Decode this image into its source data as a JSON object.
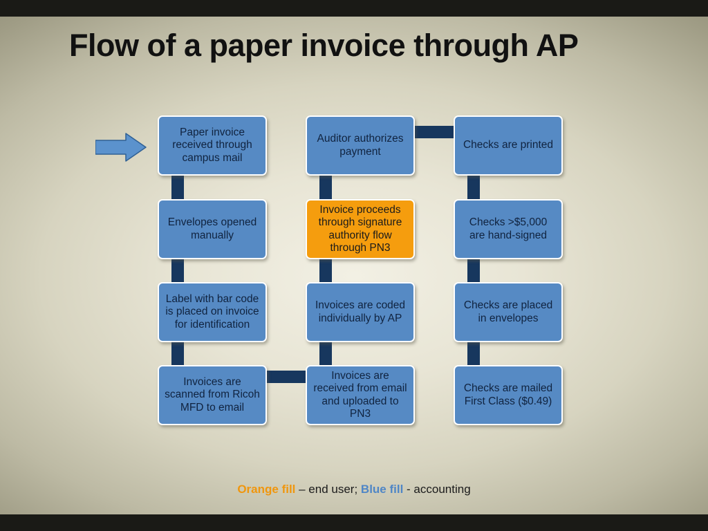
{
  "slide": {
    "title": "Flow of a paper invoice through AP",
    "legend": {
      "orange_label": "Orange fill",
      "orange_desc": " – end user; ",
      "blue_label": "Blue fill",
      "blue_desc": " - accounting"
    },
    "colors": {
      "blue_fill": "#568ac4",
      "orange_fill": "#f59d0e",
      "connector": "#17375e",
      "node_border": "#ffffff",
      "title_text": "#111111",
      "node_text": "#10233f",
      "band": "#1a1a16"
    }
  },
  "nodes": [
    {
      "id": "n1",
      "text": "Paper invoice received through campus mail",
      "fill": "blue"
    },
    {
      "id": "n2",
      "text": "Envelopes opened manually",
      "fill": "blue"
    },
    {
      "id": "n3",
      "text": "Label with bar code is placed on invoice for identification",
      "fill": "blue"
    },
    {
      "id": "n4",
      "text": "Invoices are scanned from Ricoh MFD to email",
      "fill": "blue"
    },
    {
      "id": "n5",
      "text": "Invoices are received from email and uploaded to PN3",
      "fill": "blue"
    },
    {
      "id": "n6",
      "text": "Invoices are coded individually by AP",
      "fill": "blue"
    },
    {
      "id": "n7",
      "text": "Invoice proceeds through signature authority flow through PN3",
      "fill": "orange"
    },
    {
      "id": "n8",
      "text": "Auditor authorizes payment",
      "fill": "blue"
    },
    {
      "id": "n9",
      "text": "Checks are printed",
      "fill": "blue"
    },
    {
      "id": "n10",
      "text": "Checks >$5,000 are hand-signed",
      "fill": "blue"
    },
    {
      "id": "n11",
      "text": "Checks are placed in envelopes",
      "fill": "blue"
    },
    {
      "id": "n12",
      "text": "Checks are mailed First Class ($0.49)",
      "fill": "blue"
    }
  ],
  "icons": {
    "start_arrow": "right-arrow-icon"
  }
}
